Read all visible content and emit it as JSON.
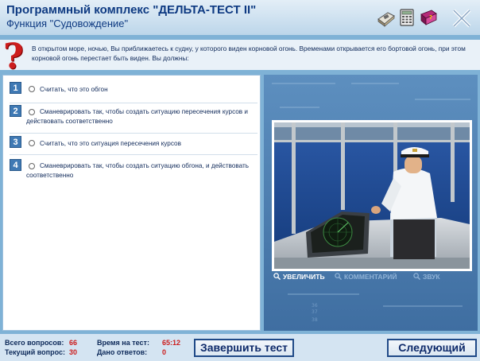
{
  "header": {
    "title": "Программный комплекс \"ДЕЛЬТА-ТЕСТ II\"",
    "subtitle": "Функция \"Судовождение\"",
    "icons": [
      "calculator-book-icon",
      "calculator-icon",
      "help-book-icon",
      "close-icon"
    ]
  },
  "question": {
    "text": "В открытом море, ночью, Вы приближаетесь к судну, у которого виден корновой огонь. Временами открывается его бортовой огонь, при этом корновой огонь перестает быть виден. Вы должны:"
  },
  "answers": [
    {
      "num": "1",
      "text": "Считать, что это обгон"
    },
    {
      "num": "2",
      "text": "Сманеврировать так, чтобы создать ситуацию пересечения курсов и действовать соответственно"
    },
    {
      "num": "3",
      "text": "Считать, что это ситуация пересечения курсов"
    },
    {
      "num": "4",
      "text": "Сманеврировать так, чтобы создать ситуацию обгона, и действовать соответственно"
    }
  ],
  "image_panel": {
    "zoom_label": "УВЕЛИЧИТЬ",
    "comment_label": "КОММЕНТАРИЙ",
    "sound_label": "ЗВУК"
  },
  "footer": {
    "total_label": "Всего вопросов:",
    "total_value": "66",
    "current_label": "Текущий вопрос:",
    "current_value": "30",
    "time_label": "Время на тест:",
    "time_value": "65:12",
    "answered_label": "Дано ответов:",
    "answered_value": "0",
    "finish_label": "Завершить тест",
    "next_label": "Следующий"
  },
  "colors": {
    "accent": "#0e3a82",
    "highlight": "#cc1d1d",
    "panel": "#7fb2d6"
  }
}
